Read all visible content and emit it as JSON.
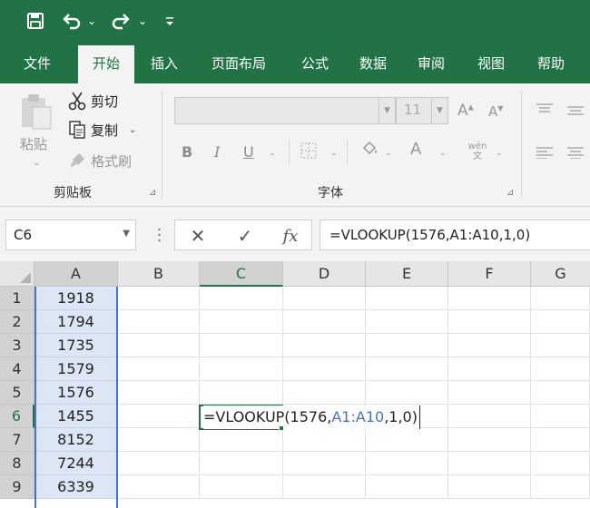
{
  "quick_access": {
    "icons": [
      "save-icon",
      "undo-icon",
      "redo-icon",
      "customize-icon"
    ],
    "dropdown_glyph": "⌄"
  },
  "tabs": [
    {
      "label": "文件"
    },
    {
      "label": "开始"
    },
    {
      "label": "插入"
    },
    {
      "label": "页面布局"
    },
    {
      "label": "公式"
    },
    {
      "label": "数据"
    },
    {
      "label": "审阅"
    },
    {
      "label": "视图"
    },
    {
      "label": "帮助"
    }
  ],
  "active_tab": "开始",
  "clipboard": {
    "paste_label": "粘贴",
    "cut_label": "剪切",
    "copy_label": "复制",
    "format_painter_label": "格式刷",
    "group_label": "剪贴板"
  },
  "font": {
    "font_name": "",
    "font_size": "11",
    "increase_label": "A",
    "decrease_label": "A",
    "bold_label": "B",
    "italic_label": "I",
    "underline_label": "U",
    "font_color_label": "A",
    "phonetic_label": "wén 文",
    "group_label": "字体"
  },
  "formula_bar": {
    "name_box": "C6",
    "cancel_glyph": "✕",
    "enter_glyph": "✓",
    "fx_label": "fx",
    "formula": "=VLOOKUP(1576,A1:A10,1,0)"
  },
  "grid": {
    "columns": [
      "A",
      "B",
      "C",
      "D",
      "E",
      "F",
      "G"
    ],
    "rows": [
      "1",
      "2",
      "3",
      "4",
      "5",
      "6",
      "7",
      "8",
      "9"
    ],
    "column_a_values": [
      "1918",
      "1794",
      "1735",
      "1579",
      "1576",
      "1455",
      "8152",
      "7244",
      "6339"
    ],
    "active_cell": "C6",
    "editing": {
      "prefix": "=VLOOKUP(1576,",
      "ref": "A1:A10",
      "suffix": ",1,0)"
    }
  },
  "colors": {
    "brand": "#217346",
    "range_highlight": "#4472c4",
    "range_fill": "#dce6f4"
  }
}
